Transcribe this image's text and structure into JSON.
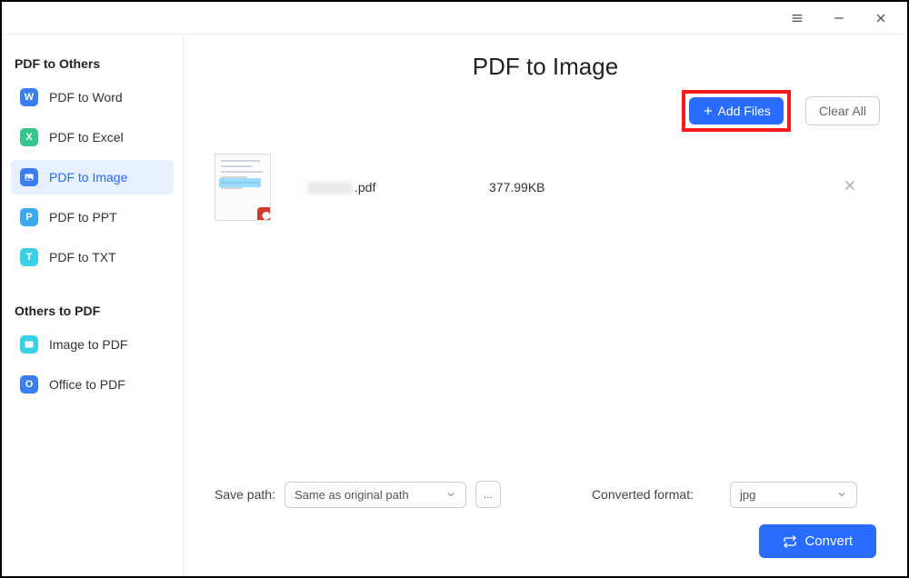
{
  "sidebar": {
    "section1_title": "PDF to Others",
    "section2_title": "Others to PDF",
    "items1": [
      {
        "label": "PDF to Word",
        "glyph": "W"
      },
      {
        "label": "PDF to Excel",
        "glyph": "X"
      },
      {
        "label": "PDF to Image",
        "glyph": ""
      },
      {
        "label": "PDF to PPT",
        "glyph": "P"
      },
      {
        "label": "PDF to TXT",
        "glyph": "T"
      }
    ],
    "items2": [
      {
        "label": "Image to PDF",
        "glyph": ""
      },
      {
        "label": "Office to PDF",
        "glyph": "O"
      }
    ]
  },
  "main": {
    "title": "PDF to Image",
    "add_files_label": "Add Files",
    "clear_all_label": "Clear All"
  },
  "files": [
    {
      "name_suffix": ".pdf",
      "size": "377.99KB"
    }
  ],
  "footer": {
    "save_path_label": "Save path:",
    "save_path_value": "Same as original path",
    "browse_label": "...",
    "format_label": "Converted format:",
    "format_value": "jpg",
    "convert_label": "Convert"
  }
}
